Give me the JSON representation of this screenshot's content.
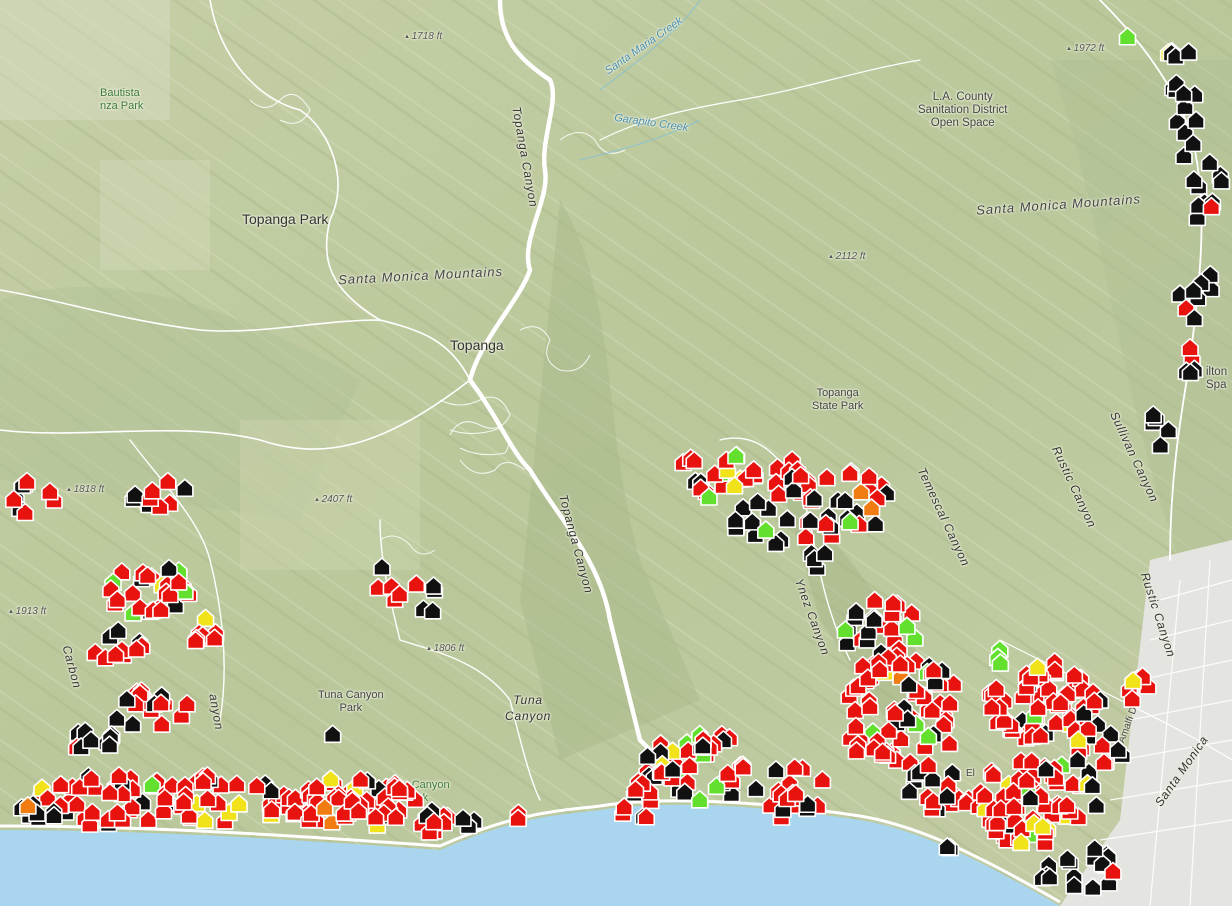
{
  "map": {
    "place_labels": {
      "topanga_park": "Topanga Park",
      "topanga": "Topanga",
      "la_county": "L.A. County\nSanitation District\nOpen Space",
      "topanga_state_park": "Topanga\nState Park",
      "tuna_canyon_park": "Tuna Canyon\nPark",
      "tuna_canyon_park_coast": "Tuna Canyon\nPark",
      "bautista_park": "Bautista\nnza Park",
      "wilton_partial": "ilton\nSpa"
    },
    "mountain_labels": {
      "smm_west": "Santa Monica Mountains",
      "smm_east": "Santa Monica Mountains"
    },
    "road_labels": {
      "topanga_canyon_north": "Topanga Canyon",
      "topanga_canyon_south": "Topanga Canyon",
      "tuna_canyon": "Tuna\nCanyon",
      "ynez_canyon": "Ynez Canyon",
      "temescal_canyon": "Temescal Canyon",
      "rustic_canyon_north": "Rustic Canyon",
      "rustic_canyon_south": "Rustic Canyon",
      "sullivan_canyon": "Sullivan Canyon",
      "carbon": "Carbon",
      "canyon_partial": "anyon",
      "santa_monica_partial": "Santa Monica",
      "amalfi": "Amalfi Dr",
      "el_partial": "El"
    },
    "water_labels": {
      "santa_maria_creek": "Santa Maria Creek",
      "garapito_creek": "Garapito Creek"
    },
    "elevations": {
      "e1718": "1718 ft",
      "e1972": "1972 ft",
      "e2112": "2112 ft",
      "e1818": "1818 ft",
      "e2407": "2407 ft",
      "e1913": "1913 ft",
      "e1806": "1806 ft"
    },
    "damage_status_colors": {
      "destroyed": "#e8120e",
      "major": "#f07c12",
      "minor": "#f2e21a",
      "affected": "#63e02d",
      "no_damage": "#111111"
    }
  }
}
